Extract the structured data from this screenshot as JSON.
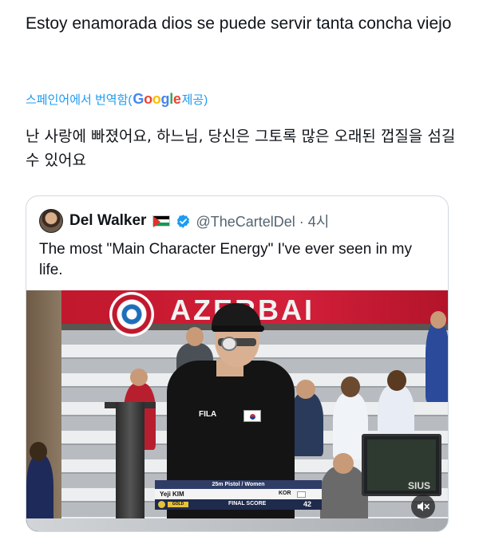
{
  "tweet": {
    "text": "Estoy enamorada dios se puede servir tanta concha viejo"
  },
  "translation": {
    "prefix": "스페인어에서 번역함(",
    "provider_logo_letters": [
      "G",
      "o",
      "o",
      "g",
      "l",
      "e"
    ],
    "suffix": " 제공)",
    "text": "난 사랑에 빠졌어요, 하느님, 당신은 그토록 많은 오래된 껍질을 섬길 수 있어요"
  },
  "quote_tweet": {
    "author_name": "Del Walker",
    "flag_icon": "palestine-flag-icon",
    "verified_icon": "verified-badge-icon",
    "handle": "@TheCartelDel",
    "separator": " · ",
    "time": "4시",
    "text": "The most \"Main Character Energy\" I've ever seen in my life."
  },
  "media": {
    "banner_text": "AZERBAI",
    "monitor_brand": "SIUS",
    "scoreboard": {
      "event": "25m Pistol / Women",
      "athlete": "Yeji KIM",
      "country": "KOR",
      "medal": "GOLD",
      "final_label": "FINAL SCORE",
      "score": "42"
    },
    "mute_icon": "speaker-muted-icon"
  },
  "colors": {
    "link_blue": "#1d9bf0",
    "secondary_text": "#536471",
    "border": "#cfd9de",
    "google_blue": "#4285f4",
    "google_red": "#ea4335",
    "google_yellow": "#fbbc05",
    "google_green": "#34a853"
  }
}
